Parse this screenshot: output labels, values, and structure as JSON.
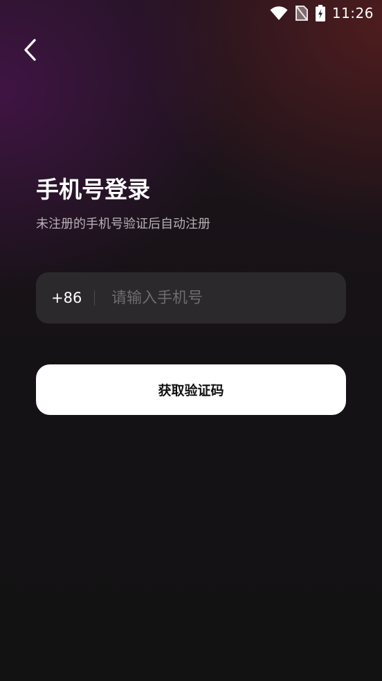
{
  "status_bar": {
    "time": "11:26",
    "icons": [
      "wifi-icon",
      "no-sim-icon",
      "battery-charging-icon"
    ]
  },
  "header": {
    "back_icon": "chevron-left-icon"
  },
  "login": {
    "title": "手机号登录",
    "subtitle": "未注册的手机号验证后自动注册",
    "country_code": "+86",
    "phone_value": "",
    "phone_placeholder": "请输入手机号",
    "get_code_label": "获取验证码"
  },
  "colors": {
    "background": "#131213",
    "field_background": "#2b292c",
    "button_background": "#ffffff",
    "button_text": "#111111",
    "subtitle_text": "#b6b1b6",
    "placeholder_text": "#6f6b70"
  }
}
